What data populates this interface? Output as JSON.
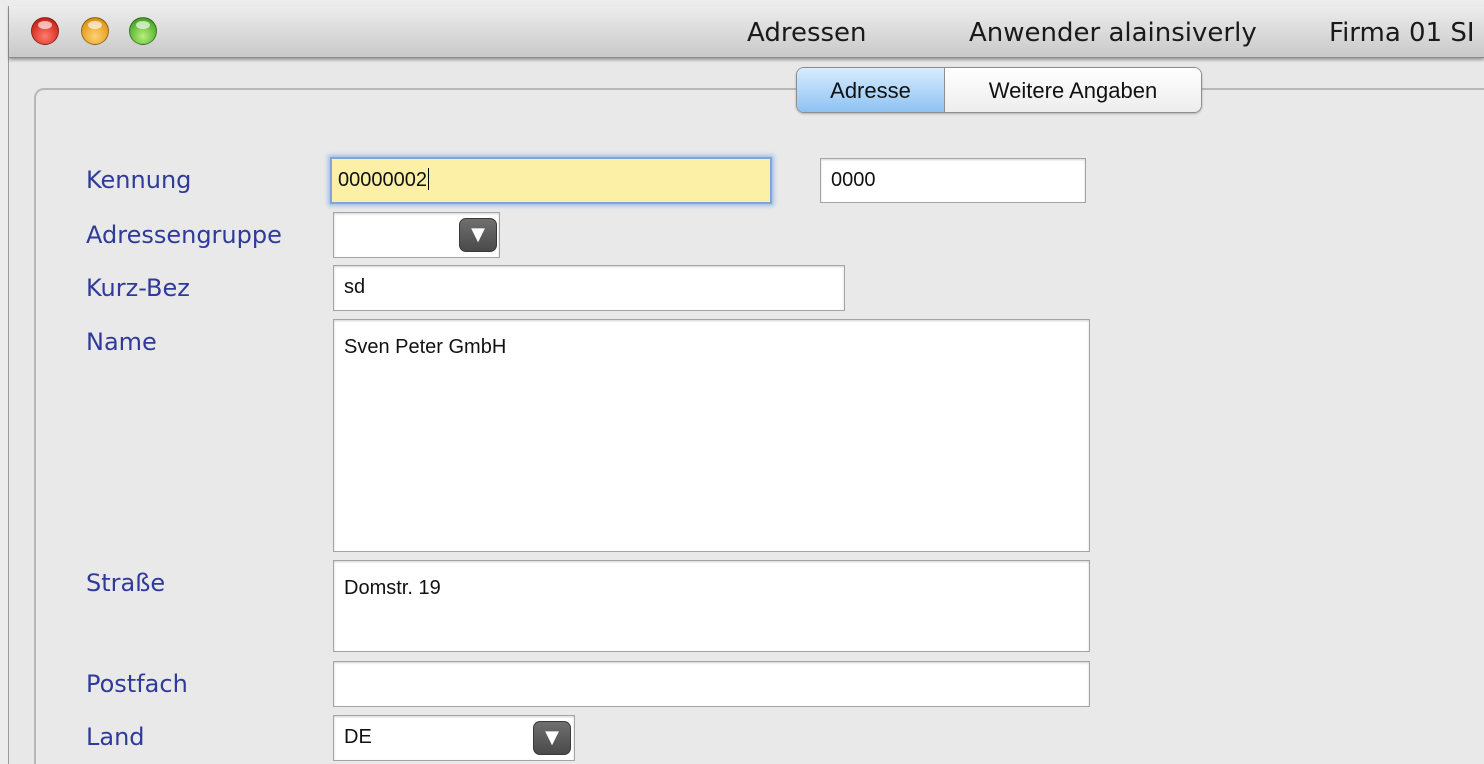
{
  "window": {
    "title": "Adressen",
    "user": "Anwender alainsiverly",
    "company": "Firma 01 SI"
  },
  "tabs": [
    {
      "label": "Adresse",
      "active": true
    },
    {
      "label": "Weitere Angaben",
      "active": false
    }
  ],
  "form": {
    "kennung": {
      "label": "Kennung",
      "value": "00000002",
      "value2": "0000"
    },
    "adressengruppe": {
      "label": "Adressengruppe",
      "value": ""
    },
    "kurz_bez": {
      "label": "Kurz-Bez",
      "value": "sd"
    },
    "name": {
      "label": "Name",
      "value": "Sven Peter GmbH"
    },
    "strasse": {
      "label": "Straße",
      "value": "Domstr. 19"
    },
    "postfach": {
      "label": "Postfach",
      "value": ""
    },
    "land": {
      "label": "Land",
      "value": "DE"
    }
  },
  "icons": {
    "dropdown": "chevron-down-icon",
    "window_controls": [
      "close-icon",
      "minimize-icon",
      "zoom-icon"
    ]
  },
  "colors": {
    "label_text": "#2f3a9a",
    "focused_field_bg": "#fbf0a6",
    "active_tab": "#8ec2f2"
  }
}
